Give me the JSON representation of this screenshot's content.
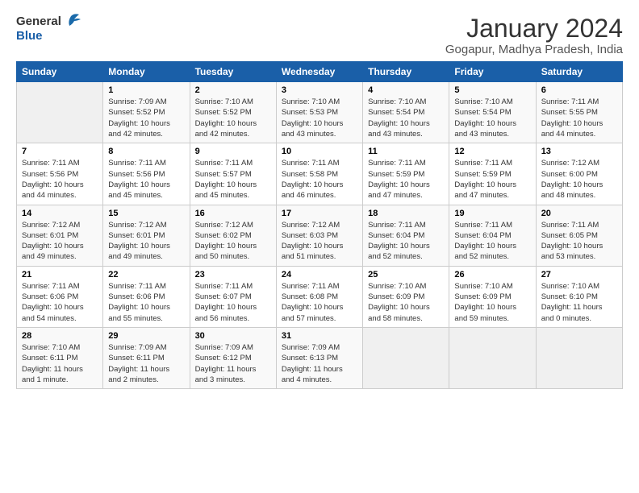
{
  "header": {
    "logo_line1": "General",
    "logo_line2": "Blue",
    "title": "January 2024",
    "subtitle": "Gogapur, Madhya Pradesh, India"
  },
  "days_of_week": [
    "Sunday",
    "Monday",
    "Tuesday",
    "Wednesday",
    "Thursday",
    "Friday",
    "Saturday"
  ],
  "weeks": [
    [
      {
        "day": "",
        "sunrise": "",
        "sunset": "",
        "daylight": ""
      },
      {
        "day": "1",
        "sunrise": "Sunrise: 7:09 AM",
        "sunset": "Sunset: 5:52 PM",
        "daylight": "Daylight: 10 hours and 42 minutes."
      },
      {
        "day": "2",
        "sunrise": "Sunrise: 7:10 AM",
        "sunset": "Sunset: 5:52 PM",
        "daylight": "Daylight: 10 hours and 42 minutes."
      },
      {
        "day": "3",
        "sunrise": "Sunrise: 7:10 AM",
        "sunset": "Sunset: 5:53 PM",
        "daylight": "Daylight: 10 hours and 43 minutes."
      },
      {
        "day": "4",
        "sunrise": "Sunrise: 7:10 AM",
        "sunset": "Sunset: 5:54 PM",
        "daylight": "Daylight: 10 hours and 43 minutes."
      },
      {
        "day": "5",
        "sunrise": "Sunrise: 7:10 AM",
        "sunset": "Sunset: 5:54 PM",
        "daylight": "Daylight: 10 hours and 43 minutes."
      },
      {
        "day": "6",
        "sunrise": "Sunrise: 7:11 AM",
        "sunset": "Sunset: 5:55 PM",
        "daylight": "Daylight: 10 hours and 44 minutes."
      }
    ],
    [
      {
        "day": "7",
        "sunrise": "Sunrise: 7:11 AM",
        "sunset": "Sunset: 5:56 PM",
        "daylight": "Daylight: 10 hours and 44 minutes."
      },
      {
        "day": "8",
        "sunrise": "Sunrise: 7:11 AM",
        "sunset": "Sunset: 5:56 PM",
        "daylight": "Daylight: 10 hours and 45 minutes."
      },
      {
        "day": "9",
        "sunrise": "Sunrise: 7:11 AM",
        "sunset": "Sunset: 5:57 PM",
        "daylight": "Daylight: 10 hours and 45 minutes."
      },
      {
        "day": "10",
        "sunrise": "Sunrise: 7:11 AM",
        "sunset": "Sunset: 5:58 PM",
        "daylight": "Daylight: 10 hours and 46 minutes."
      },
      {
        "day": "11",
        "sunrise": "Sunrise: 7:11 AM",
        "sunset": "Sunset: 5:59 PM",
        "daylight": "Daylight: 10 hours and 47 minutes."
      },
      {
        "day": "12",
        "sunrise": "Sunrise: 7:11 AM",
        "sunset": "Sunset: 5:59 PM",
        "daylight": "Daylight: 10 hours and 47 minutes."
      },
      {
        "day": "13",
        "sunrise": "Sunrise: 7:12 AM",
        "sunset": "Sunset: 6:00 PM",
        "daylight": "Daylight: 10 hours and 48 minutes."
      }
    ],
    [
      {
        "day": "14",
        "sunrise": "Sunrise: 7:12 AM",
        "sunset": "Sunset: 6:01 PM",
        "daylight": "Daylight: 10 hours and 49 minutes."
      },
      {
        "day": "15",
        "sunrise": "Sunrise: 7:12 AM",
        "sunset": "Sunset: 6:01 PM",
        "daylight": "Daylight: 10 hours and 49 minutes."
      },
      {
        "day": "16",
        "sunrise": "Sunrise: 7:12 AM",
        "sunset": "Sunset: 6:02 PM",
        "daylight": "Daylight: 10 hours and 50 minutes."
      },
      {
        "day": "17",
        "sunrise": "Sunrise: 7:12 AM",
        "sunset": "Sunset: 6:03 PM",
        "daylight": "Daylight: 10 hours and 51 minutes."
      },
      {
        "day": "18",
        "sunrise": "Sunrise: 7:11 AM",
        "sunset": "Sunset: 6:04 PM",
        "daylight": "Daylight: 10 hours and 52 minutes."
      },
      {
        "day": "19",
        "sunrise": "Sunrise: 7:11 AM",
        "sunset": "Sunset: 6:04 PM",
        "daylight": "Daylight: 10 hours and 52 minutes."
      },
      {
        "day": "20",
        "sunrise": "Sunrise: 7:11 AM",
        "sunset": "Sunset: 6:05 PM",
        "daylight": "Daylight: 10 hours and 53 minutes."
      }
    ],
    [
      {
        "day": "21",
        "sunrise": "Sunrise: 7:11 AM",
        "sunset": "Sunset: 6:06 PM",
        "daylight": "Daylight: 10 hours and 54 minutes."
      },
      {
        "day": "22",
        "sunrise": "Sunrise: 7:11 AM",
        "sunset": "Sunset: 6:06 PM",
        "daylight": "Daylight: 10 hours and 55 minutes."
      },
      {
        "day": "23",
        "sunrise": "Sunrise: 7:11 AM",
        "sunset": "Sunset: 6:07 PM",
        "daylight": "Daylight: 10 hours and 56 minutes."
      },
      {
        "day": "24",
        "sunrise": "Sunrise: 7:11 AM",
        "sunset": "Sunset: 6:08 PM",
        "daylight": "Daylight: 10 hours and 57 minutes."
      },
      {
        "day": "25",
        "sunrise": "Sunrise: 7:10 AM",
        "sunset": "Sunset: 6:09 PM",
        "daylight": "Daylight: 10 hours and 58 minutes."
      },
      {
        "day": "26",
        "sunrise": "Sunrise: 7:10 AM",
        "sunset": "Sunset: 6:09 PM",
        "daylight": "Daylight: 10 hours and 59 minutes."
      },
      {
        "day": "27",
        "sunrise": "Sunrise: 7:10 AM",
        "sunset": "Sunset: 6:10 PM",
        "daylight": "Daylight: 11 hours and 0 minutes."
      }
    ],
    [
      {
        "day": "28",
        "sunrise": "Sunrise: 7:10 AM",
        "sunset": "Sunset: 6:11 PM",
        "daylight": "Daylight: 11 hours and 1 minute."
      },
      {
        "day": "29",
        "sunrise": "Sunrise: 7:09 AM",
        "sunset": "Sunset: 6:11 PM",
        "daylight": "Daylight: 11 hours and 2 minutes."
      },
      {
        "day": "30",
        "sunrise": "Sunrise: 7:09 AM",
        "sunset": "Sunset: 6:12 PM",
        "daylight": "Daylight: 11 hours and 3 minutes."
      },
      {
        "day": "31",
        "sunrise": "Sunrise: 7:09 AM",
        "sunset": "Sunset: 6:13 PM",
        "daylight": "Daylight: 11 hours and 4 minutes."
      },
      {
        "day": "",
        "sunrise": "",
        "sunset": "",
        "daylight": ""
      },
      {
        "day": "",
        "sunrise": "",
        "sunset": "",
        "daylight": ""
      },
      {
        "day": "",
        "sunrise": "",
        "sunset": "",
        "daylight": ""
      }
    ]
  ]
}
